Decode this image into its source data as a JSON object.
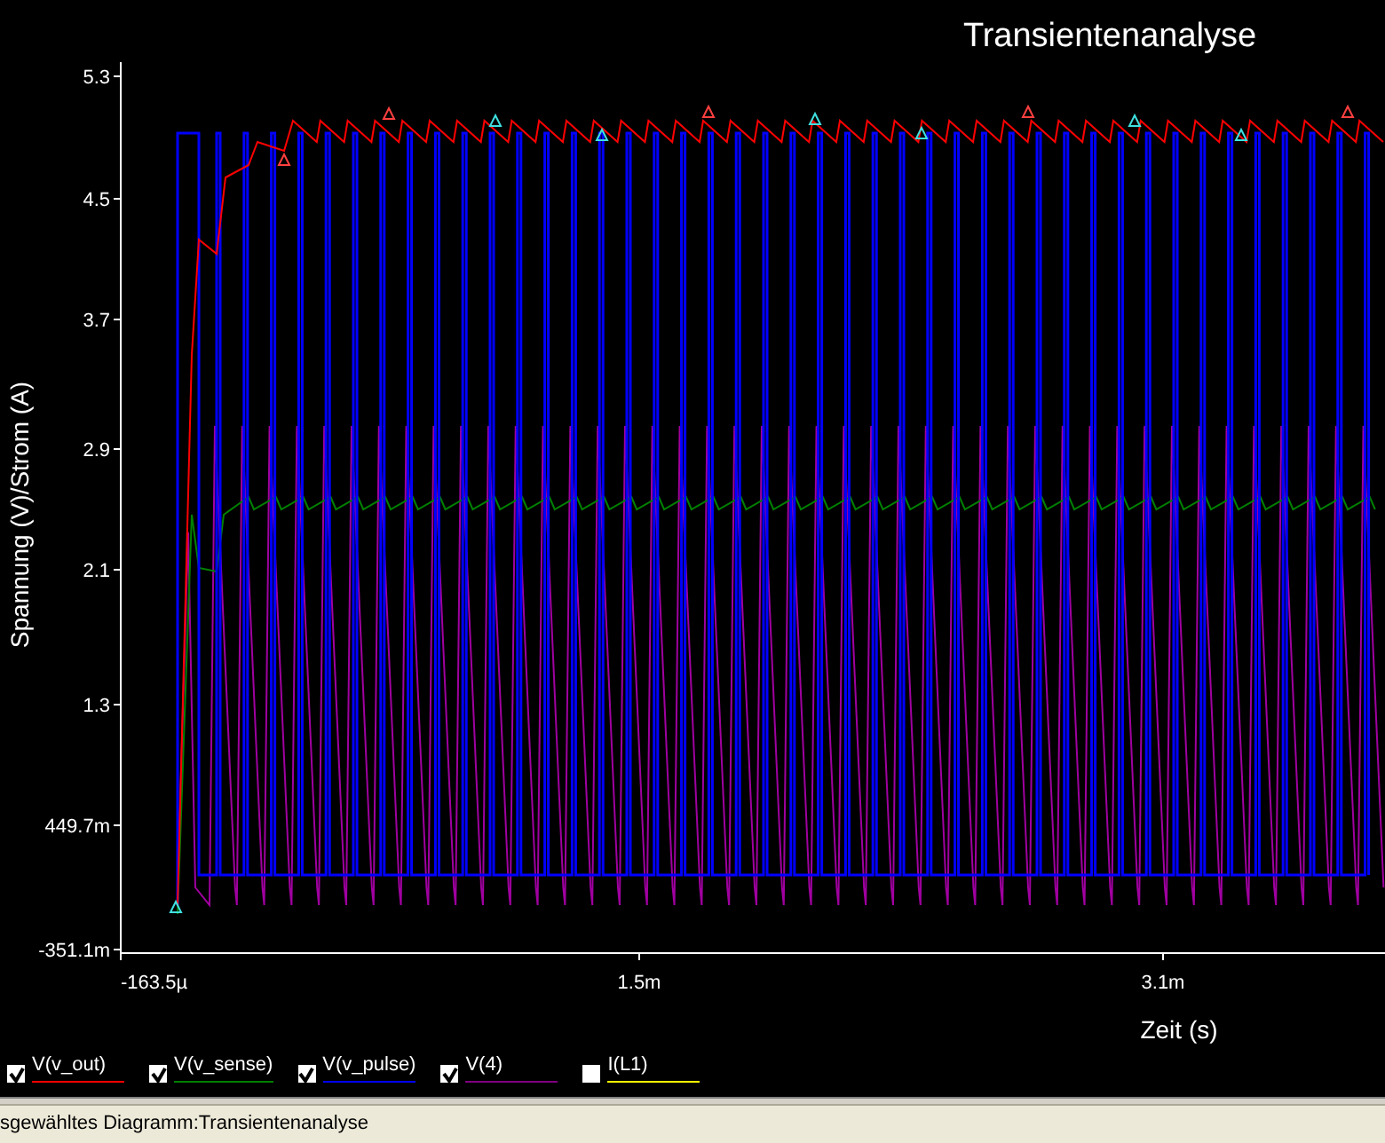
{
  "plot": {
    "title": "Transientenanalyse",
    "ylabel": "Spannung (V)/Strom (A)",
    "xlabel": "Zeit (s)",
    "y_ticks": [
      "5.3",
      "4.5",
      "3.7",
      "2.9",
      "2.1",
      "1.3",
      "449.7m",
      "-351.1m"
    ],
    "x_ticks": [
      "-163.5µ",
      "1.5m",
      "3.1m"
    ]
  },
  "legend": [
    {
      "label": "V(v_out)",
      "checked": true,
      "color": "#ff0000"
    },
    {
      "label": "V(v_sense)",
      "checked": true,
      "color": "#008000"
    },
    {
      "label": "V(v_pulse)",
      "checked": true,
      "color": "#0000ff"
    },
    {
      "label": "V(4)",
      "checked": true,
      "color": "#800080"
    },
    {
      "label": "I(L1)",
      "checked": false,
      "color": "#ffff00"
    }
  ],
  "status_bar": "sgewähltes Diagramm:Transientenanalyse"
}
